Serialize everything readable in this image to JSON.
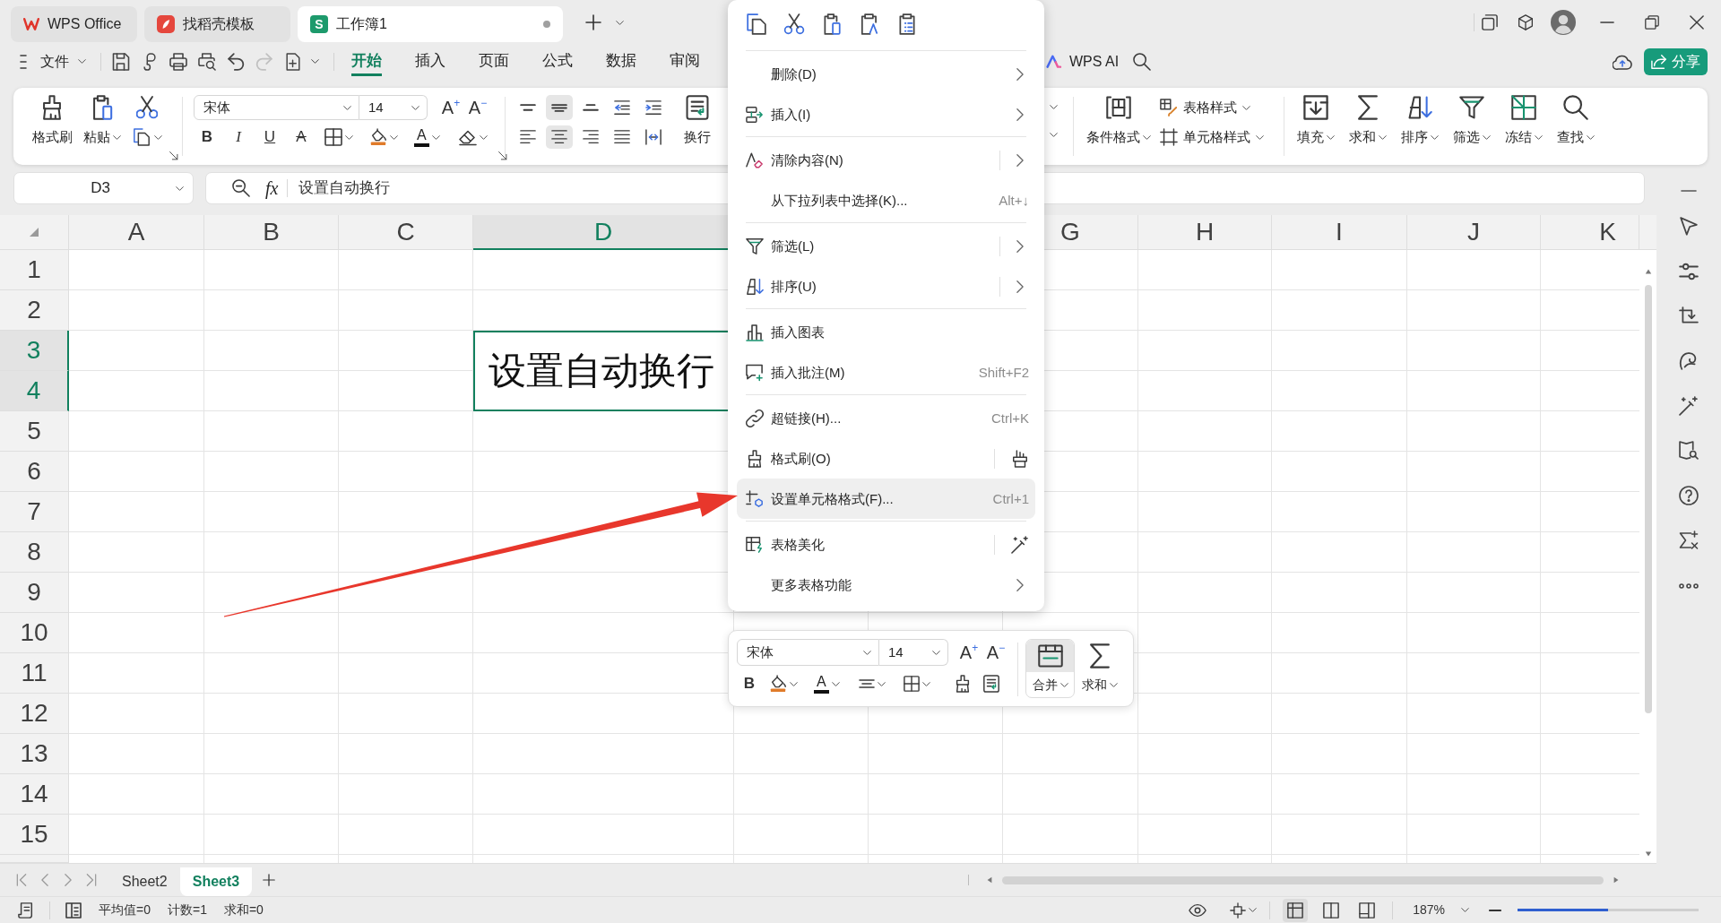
{
  "tabs": [
    {
      "label": "WPS Office",
      "kind": "wps",
      "selected": false,
      "unsaved": false
    },
    {
      "label": "找稻壳模板",
      "kind": "docer",
      "selected": false,
      "unsaved": false
    },
    {
      "label": "工作簿1",
      "kind": "sheet",
      "logo": "S",
      "selected": true,
      "unsaved": true
    }
  ],
  "menu_bar": {
    "file": "文件",
    "tabs": [
      {
        "label": "开始",
        "selected": true
      },
      {
        "label": "插入",
        "selected": false
      },
      {
        "label": "页面",
        "selected": false
      },
      {
        "label": "公式",
        "selected": false
      },
      {
        "label": "数据",
        "selected": false
      },
      {
        "label": "审阅",
        "selected": false
      }
    ],
    "ai": "WPS AI",
    "share": "分享"
  },
  "ribbon": {
    "clipboard": [
      "格式刷",
      "粘贴"
    ],
    "font": {
      "name": "宋体",
      "size": "14",
      "grow": "A$^{+}$",
      "shrink": "A$^{−}$",
      "styles": [
        {
          "kind": "bold",
          "label": "B"
        },
        {
          "kind": "italic",
          "label": "I"
        },
        {
          "kind": "underline",
          "label": "U"
        },
        {
          "kind": "strike",
          "label": "A"
        }
      ],
      "font_color": "A"
    },
    "alignment": [
      {
        "selected": false
      },
      {
        "selected": true
      },
      {
        "selected": false
      },
      {
        "selected": false
      },
      {
        "selected": false
      },
      {
        "selected": false
      },
      {
        "selected": true
      },
      {
        "selected": false
      },
      {
        "selected": false
      },
      {
        "selected": false
      }
    ],
    "wrap": "换行",
    "styles": [
      "条件格式",
      "表格样式",
      "单元格样式"
    ],
    "editing": [
      "填充",
      "求和",
      "排序",
      "筛选",
      "冻结",
      "查找"
    ]
  },
  "formula_bar": {
    "name_box": "D3",
    "fx": "fx",
    "formula": "设置自动换行"
  },
  "sheet": {
    "columns": [
      {
        "label": "A",
        "selected": false
      },
      {
        "label": "B",
        "selected": false
      },
      {
        "label": "C",
        "selected": false
      },
      {
        "label": "D",
        "selected": true
      },
      {
        "label": "G",
        "selected": false
      },
      {
        "label": "H",
        "selected": false
      },
      {
        "label": "I",
        "selected": false
      },
      {
        "label": "J",
        "selected": false
      },
      {
        "label": "K",
        "selected": false
      }
    ],
    "rows": [
      {
        "label": "1",
        "selected": false
      },
      {
        "label": "2",
        "selected": false
      },
      {
        "label": "3",
        "selected": true
      },
      {
        "label": "4",
        "selected": true
      },
      {
        "label": "5",
        "selected": false
      },
      {
        "label": "6",
        "selected": false
      },
      {
        "label": "7",
        "selected": false
      },
      {
        "label": "8",
        "selected": false
      },
      {
        "label": "9",
        "selected": false
      },
      {
        "label": "10",
        "selected": false
      },
      {
        "label": "11",
        "selected": false
      },
      {
        "label": "12",
        "selected": false
      },
      {
        "label": "13",
        "selected": false
      },
      {
        "label": "14",
        "selected": false
      },
      {
        "label": "15",
        "selected": false
      }
    ],
    "cell": {
      "text": "设置自动换行"
    }
  },
  "context_menu": {
    "groups": [
      [
        {
          "label": "删除(D)",
          "submenu": true,
          "split": false,
          "highlighted": false
        },
        {
          "label": "插入(I)",
          "submenu": true,
          "split": false,
          "highlighted": false
        }
      ],
      [
        {
          "label": "清除内容(N)",
          "submenu": true,
          "split": true,
          "highlighted": false
        },
        {
          "label": "从下拉列表中选择(K)...",
          "shortcut": "Alt+↓",
          "submenu": false,
          "split": false,
          "highlighted": false
        }
      ],
      [
        {
          "label": "筛选(L)",
          "submenu": true,
          "split": true,
          "highlighted": false
        },
        {
          "label": "排序(U)",
          "submenu": true,
          "split": true,
          "highlighted": false
        }
      ],
      [
        {
          "label": "插入图表",
          "submenu": false,
          "split": false,
          "highlighted": false
        },
        {
          "label": "插入批注(M)",
          "shortcut": "Shift+F2",
          "submenu": false,
          "split": false,
          "highlighted": false
        }
      ],
      [
        {
          "label": "超链接(H)...",
          "shortcut": "Ctrl+K",
          "submenu": false,
          "split": false,
          "highlighted": false
        },
        {
          "label": "格式刷(O)",
          "submenu": false,
          "split": true,
          "highlighted": false
        },
        {
          "label": "设置单元格格式(F)...",
          "shortcut": "Ctrl+1",
          "submenu": false,
          "split": false,
          "highlighted": true
        }
      ],
      [
        {
          "label": "表格美化",
          "submenu": false,
          "split": true,
          "highlighted": false
        },
        {
          "label": "更多表格功能",
          "submenu": true,
          "split": false,
          "highlighted": false
        }
      ]
    ]
  },
  "mini_toolbar": {
    "font": "宋体",
    "size": "14",
    "grow": "A$^{+}$",
    "shrink": "A$^{−}$",
    "bold": "B",
    "font_color": "A",
    "buttons": [
      {
        "label": "合并",
        "selected": true
      },
      {
        "label": "求和",
        "selected": false
      }
    ]
  },
  "sheet_tabs": [
    {
      "label": "Sheet2",
      "selected": false
    },
    {
      "label": "Sheet3",
      "selected": true
    }
  ],
  "status_bar": {
    "stats": [
      "平均值=0",
      "计数=1",
      "求和=0"
    ],
    "views": [
      {
        "selected": true
      },
      {
        "selected": false
      },
      {
        "selected": false
      }
    ],
    "zoom": "187%",
    "zoom_slider": {
      "level": 0.5
    }
  }
}
